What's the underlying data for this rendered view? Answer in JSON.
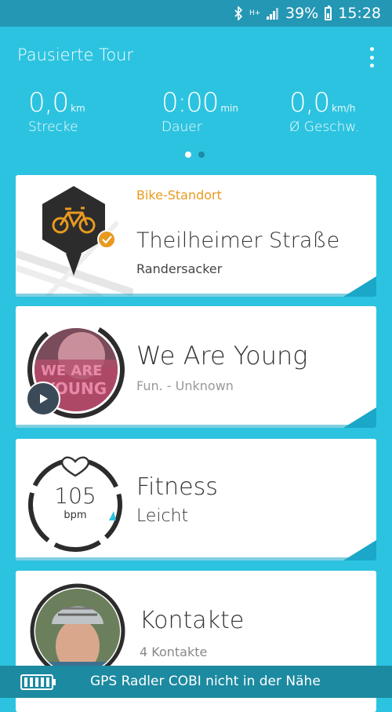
{
  "status_bar": {
    "network": "H+",
    "battery_percent": "39%",
    "time": "15:28"
  },
  "header": {
    "title": "Pausierte Tour",
    "menu_icon": "more-vertical-icon"
  },
  "stats": [
    {
      "value": "0,0",
      "unit": "km",
      "label": "Strecke"
    },
    {
      "value": "0:00",
      "unit": "min",
      "label": "Dauer"
    },
    {
      "value": "0,0",
      "unit": "km/h",
      "label": "Ø Geschw."
    }
  ],
  "pager": {
    "active_index": 0,
    "count": 2
  },
  "location_card": {
    "label": "Bike-Standort",
    "title": "Theilheimer Straße",
    "subtitle": "Randersacker",
    "accent": "#e89a1f"
  },
  "music_card": {
    "title": "We Are Young",
    "subtitle": "Fun. - Unknown",
    "album_art_text": "WE ARE YOUNG"
  },
  "fitness_card": {
    "title": "Fitness",
    "subtitle": "Leicht",
    "bpm_value": "105",
    "bpm_unit": "bpm"
  },
  "contacts_card": {
    "title": "Kontakte",
    "subtitle": "4 Kontakte"
  },
  "bottom_bar": {
    "text": "GPS Radler COBI nicht in der Nähe"
  },
  "colors": {
    "background": "#2cc3e0",
    "status_bar": "#2497b4",
    "bottom_bar": "#1c8aa0",
    "accent_orange": "#e89a1f"
  }
}
